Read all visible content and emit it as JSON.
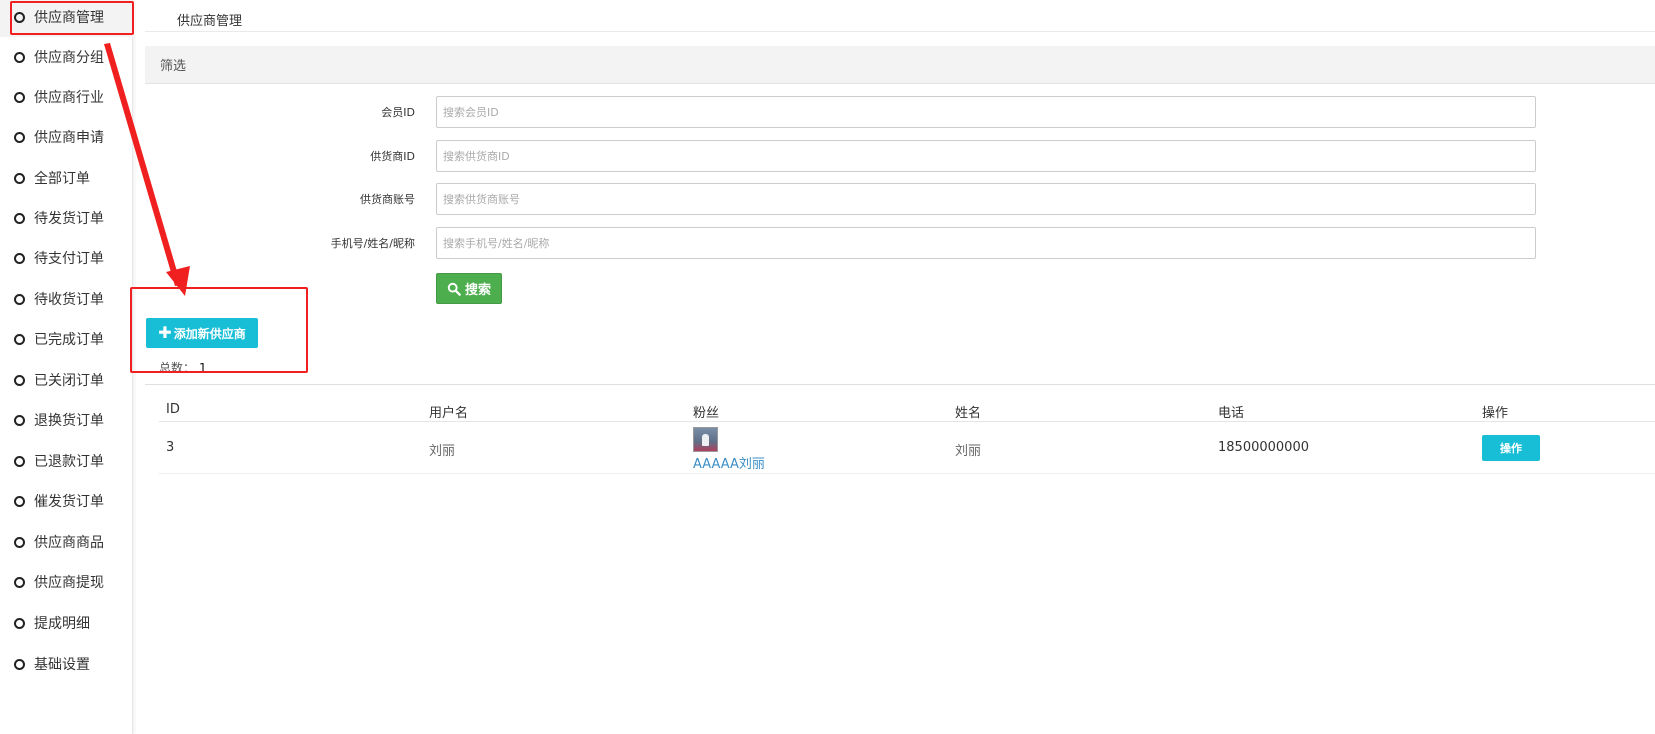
{
  "sidebar": {
    "items": [
      {
        "label": "供应商管理"
      },
      {
        "label": "供应商分组"
      },
      {
        "label": "供应商行业"
      },
      {
        "label": "供应商申请"
      },
      {
        "label": "全部订单"
      },
      {
        "label": "待发货订单"
      },
      {
        "label": "待支付订单"
      },
      {
        "label": "待收货订单"
      },
      {
        "label": "已完成订单"
      },
      {
        "label": "已关闭订单"
      },
      {
        "label": "退换货订单"
      },
      {
        "label": "已退款订单"
      },
      {
        "label": "催发货订单"
      },
      {
        "label": "供应商商品"
      },
      {
        "label": "供应商提现"
      },
      {
        "label": "提成明细"
      },
      {
        "label": "基础设置"
      }
    ]
  },
  "breadcrumb": "供应商管理",
  "filter": {
    "title": "筛选",
    "fields": [
      {
        "label": "会员ID",
        "placeholder": "搜索会员ID",
        "value": ""
      },
      {
        "label": "供货商ID",
        "placeholder": "搜索供货商ID",
        "value": ""
      },
      {
        "label": "供货商账号",
        "placeholder": "搜索供货商账号",
        "value": ""
      },
      {
        "label": "手机号/姓名/昵称",
        "placeholder": "搜索手机号/姓名/昵称",
        "value": ""
      }
    ],
    "search_label": "搜索"
  },
  "add_button_label": "添加新供应商",
  "total": {
    "label": "总数：",
    "value": "1"
  },
  "table": {
    "headers": [
      "ID",
      "用户名",
      "粉丝",
      "姓名",
      "电话",
      "操作"
    ],
    "rows": [
      {
        "id": "3",
        "username": "刘丽",
        "fan": "AAAAA刘丽",
        "name": "刘丽",
        "phone": "18500000000",
        "action": "操作"
      }
    ]
  },
  "colors": {
    "accent_cyan": "#17bed6",
    "search_green": "#4cae4c",
    "annotation_red": "#f02020",
    "link_blue": "#3b8fc7"
  }
}
